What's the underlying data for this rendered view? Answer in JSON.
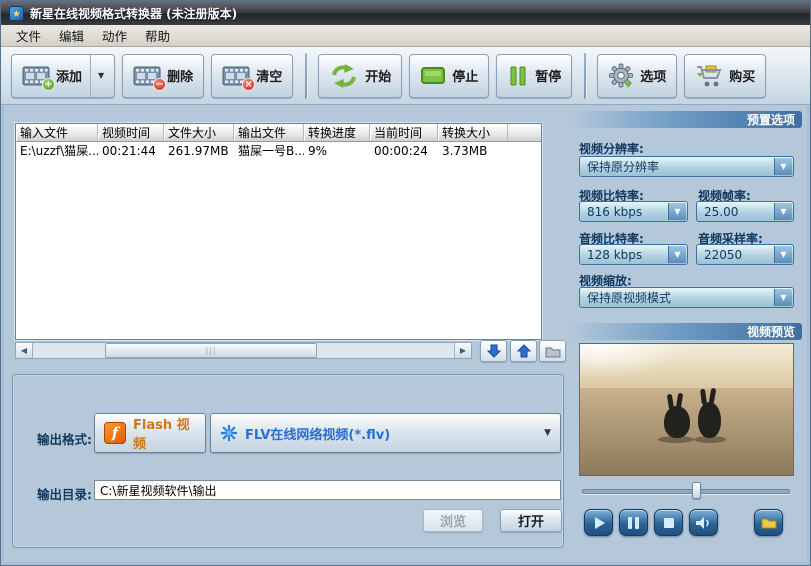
{
  "window": {
    "title": "新星在线视频格式转换器 (未注册版本)"
  },
  "menu": {
    "file": "文件",
    "edit": "编辑",
    "action": "动作",
    "help": "帮助"
  },
  "toolbar": {
    "add": "添加",
    "remove": "删除",
    "clear": "清空",
    "start": "开始",
    "stop": "停止",
    "pause": "暂停",
    "options": "选项",
    "buy": "购买"
  },
  "table": {
    "columns": [
      "输入文件",
      "视频时间",
      "文件大小",
      "输出文件",
      "转换进度",
      "当前时间",
      "转换大小"
    ],
    "rows": [
      [
        "E:\\uzzf\\猫屎...",
        "00:21:44",
        "261.97MB",
        "猫屎一号B...",
        "9%",
        "00:00:24",
        "3.73MB"
      ]
    ]
  },
  "output": {
    "format_label": "输出格式:",
    "format_category": "Flash 视频",
    "format_value": "FLV在线网络视频(*.flv)",
    "dir_label": "输出目录:",
    "dir_value": "C:\\新星视频软件\\输出",
    "browse_label": "浏览",
    "open_label": "打开"
  },
  "presets": {
    "title": "预置选项",
    "resolution_label": "视频分辨率:",
    "resolution_value": "保持原分辨率",
    "video_bitrate_label": "视频比特率:",
    "video_bitrate_value": "816 kbps",
    "framerate_label": "视频帧率:",
    "framerate_value": "25.00",
    "audio_bitrate_label": "音频比特率:",
    "audio_bitrate_value": "128 kbps",
    "samplerate_label": "音频采样率:",
    "samplerate_value": "22050",
    "scale_label": "视频缩放:",
    "scale_value": "保持原视频模式"
  },
  "preview": {
    "title": "视频预览"
  },
  "icons": {
    "star": "★",
    "plus": "+",
    "minus": "−",
    "cross": "×",
    "caret_down": "▼",
    "scroll_left": "◀",
    "scroll_right": "▶",
    "grip": "|||",
    "f_logo": "f"
  },
  "colors": {
    "accent_blue": "#3f6f9f",
    "green": "#77b43e",
    "flash_orange": "#e05a00",
    "flv_blue": "#2a6fd4"
  }
}
